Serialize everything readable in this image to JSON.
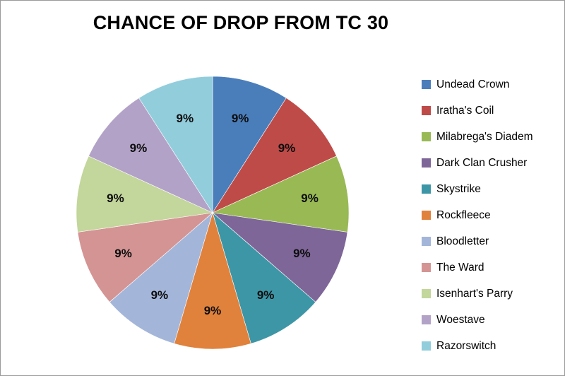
{
  "chart_data": {
    "type": "pie",
    "title": "CHANCE OF DROP FROM TC 30",
    "xlabel": "",
    "ylabel": "",
    "legend_position": "right",
    "grid": false,
    "start_angle_deg": 0,
    "direction": "clockwise",
    "data_labels": [
      "9%",
      "9%",
      "9%",
      "9%",
      "9%",
      "9%",
      "9%",
      "9%",
      "9%",
      "9%",
      "9%"
    ],
    "categories": [
      "Undead Crown",
      "Iratha's Coil",
      "Milabrega's Diadem",
      "Dark Clan Crusher",
      "Skystrike",
      "Rockfleece",
      "Bloodletter",
      "The Ward",
      "Isenhart's Parry",
      "Woestave",
      "Razorswitch"
    ],
    "values": [
      9,
      9,
      9,
      9,
      9,
      9,
      9,
      9,
      9,
      9,
      9
    ],
    "colors": [
      "#4A7EBB",
      "#BE4B48",
      "#98B954",
      "#7E6698",
      "#3D96A6",
      "#E0813C",
      "#A3B6D9",
      "#D49494",
      "#C3D69B",
      "#B2A2C7",
      "#92CDDC"
    ],
    "slices": [
      {
        "label": "Undead Crown",
        "value": 9,
        "display": "9%",
        "color": "#4A7EBB"
      },
      {
        "label": "Iratha's Coil",
        "value": 9,
        "display": "9%",
        "color": "#BE4B48"
      },
      {
        "label": "Milabrega's Diadem",
        "value": 9,
        "display": "9%",
        "color": "#98B954"
      },
      {
        "label": "Dark Clan Crusher",
        "value": 9,
        "display": "9%",
        "color": "#7E6698"
      },
      {
        "label": "Skystrike",
        "value": 9,
        "display": "9%",
        "color": "#3D96A6"
      },
      {
        "label": "Rockfleece",
        "value": 9,
        "display": "9%",
        "color": "#E0813C"
      },
      {
        "label": "Bloodletter",
        "value": 9,
        "display": "9%",
        "color": "#A3B6D9"
      },
      {
        "label": "The Ward",
        "value": 9,
        "display": "9%",
        "color": "#D49494"
      },
      {
        "label": "Isenhart's Parry",
        "value": 9,
        "display": "9%",
        "color": "#C3D69B"
      },
      {
        "label": "Woestave",
        "value": 9,
        "display": "9%",
        "color": "#B2A2C7"
      },
      {
        "label": "Razorswitch",
        "value": 9,
        "display": "9%",
        "color": "#92CDDC"
      }
    ]
  },
  "canvas": {
    "background": "#FFFFFF",
    "border_color": "#9A9A9A"
  }
}
